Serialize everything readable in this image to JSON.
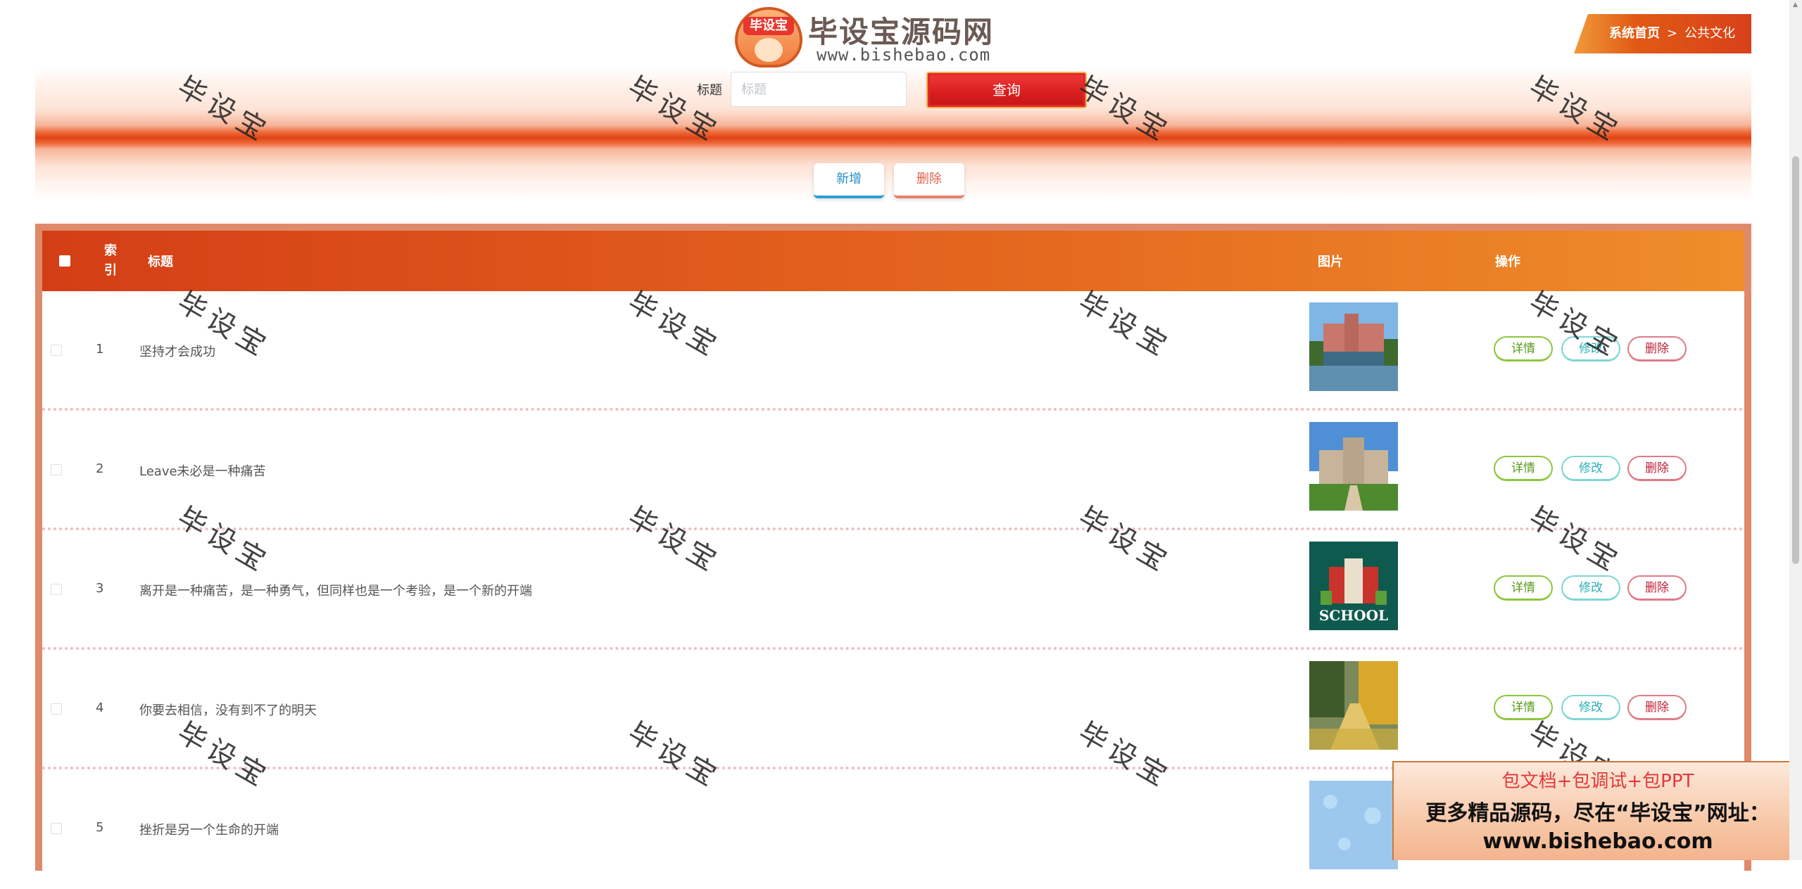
{
  "logo": {
    "badge_text": "毕设宝",
    "title": "毕设宝源码网",
    "url": "www.bishebao.com"
  },
  "breadcrumb": {
    "home": "系统首页",
    "separator": ">",
    "current": "公共文化"
  },
  "search": {
    "label": "标题",
    "placeholder": "标题",
    "value": "",
    "button_label": "查询"
  },
  "toolbar": {
    "add_label": "新增",
    "delete_label": "删除"
  },
  "table": {
    "columns": {
      "index": "索引",
      "title": "标题",
      "image": "图片",
      "action": "操作"
    },
    "actions": {
      "detail": "详情",
      "edit": "修改",
      "delete": "删除"
    },
    "rows": [
      {
        "index": "1",
        "title": "坚持才会成功",
        "image": "campus-lake-building"
      },
      {
        "index": "2",
        "title": "Leave未必是一种痛苦",
        "image": "campus-lawn-building"
      },
      {
        "index": "3",
        "title": "离开是一种痛苦，是一种勇气，但同样也是一个考验，是一个新的开端",
        "image": "back-to-school-poster",
        "image_text": "SCHOOL"
      },
      {
        "index": "4",
        "title": "你要去相信，没有到不了的明天",
        "image": "autumn-ginkgo-path"
      },
      {
        "index": "5",
        "title": "挫折是另一个生命的开端",
        "image": "blue-pattern"
      }
    ]
  },
  "watermark": "毕设宝",
  "promo": {
    "line1": "包文档+包调试+包PPT",
    "line2": "更多精品源码，尽在“毕设宝”网址：",
    "line3": "www.bishebao.com"
  },
  "colors": {
    "header_start": "#d43e16",
    "header_end": "#ee8e2a",
    "query_button": "#d81e1e",
    "breadcrumb": "#e05a14"
  }
}
